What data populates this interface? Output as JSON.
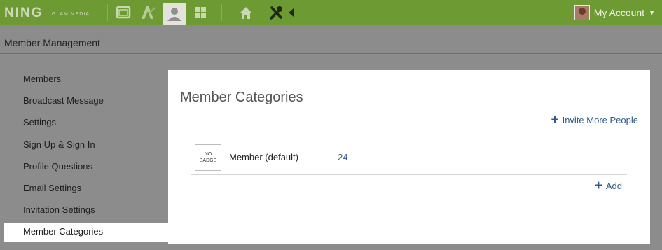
{
  "topbar": {
    "logo": "NING",
    "logo_sub": "GLAM MEDIA",
    "icons": [
      "window-icon",
      "appearance-icon",
      "members-icon",
      "grid-icon",
      "home-icon",
      "tools-icon",
      "collapse-arrow-icon"
    ],
    "account_label": "My Account",
    "accent": "#6e9a33"
  },
  "page": {
    "title": "Member Management"
  },
  "sidebar": {
    "items": [
      {
        "label": "Members"
      },
      {
        "label": "Broadcast Message"
      },
      {
        "label": "Settings"
      },
      {
        "label": "Sign Up & Sign In"
      },
      {
        "label": "Profile Questions"
      },
      {
        "label": "Email Settings"
      },
      {
        "label": "Invitation Settings"
      },
      {
        "label": "Member Categories"
      }
    ],
    "active_index": 7
  },
  "main": {
    "title": "Member Categories",
    "invite_label": "Invite More People",
    "categories": [
      {
        "badge_line1": "NO",
        "badge_line2": "BADGE",
        "name": "Member (default)",
        "count": "24"
      }
    ],
    "add_label": "Add",
    "link_color": "#2f5a8c"
  }
}
